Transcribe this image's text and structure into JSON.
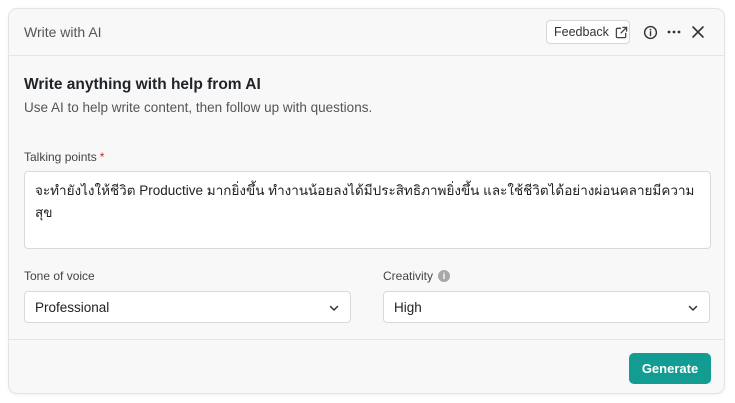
{
  "header": {
    "title": "Write with AI",
    "feedback_label": "Feedback",
    "info_icon": "info-icon",
    "more_icon": "more-icon",
    "close_icon": "close-icon"
  },
  "intro": {
    "heading": "Write anything with help from AI",
    "subheading": "Use AI to help write content, then follow up with questions."
  },
  "talking_points": {
    "label": "Talking points",
    "required_mark": "*",
    "value": "จะทำยังไงให้ชีวิต Productive มากยิ่งขึ้น ทำงานน้อยลงได้มีประสิทธิภาพยิ่งขึ้น และใช้ชีวิตได้อย่างผ่อนคลายมีความสุข"
  },
  "tone": {
    "label": "Tone of voice",
    "selected": "Professional"
  },
  "creativity": {
    "label": "Creativity",
    "info_glyph": "i",
    "selected": "High"
  },
  "footer": {
    "generate_label": "Generate"
  },
  "colors": {
    "accent": "#139c91",
    "required": "#d1242f"
  }
}
